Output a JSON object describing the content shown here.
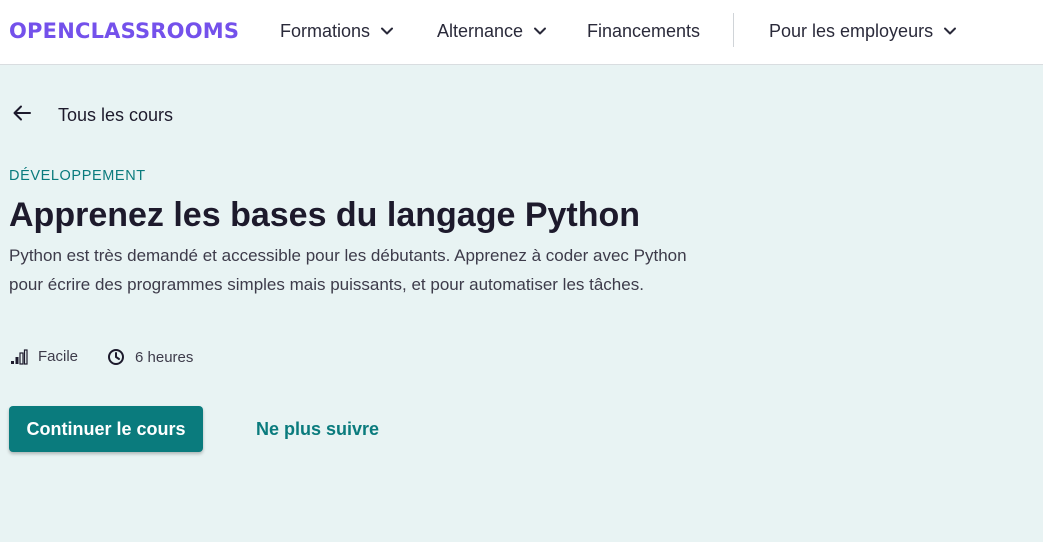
{
  "header": {
    "logo_text": "OPENCLASSROOMS",
    "nav": [
      {
        "label": "Formations",
        "has_dropdown": true
      },
      {
        "label": "Alternance",
        "has_dropdown": true
      },
      {
        "label": "Financements",
        "has_dropdown": false
      },
      {
        "label": "Pour les employeurs",
        "has_dropdown": true
      }
    ]
  },
  "back_link": {
    "label": "Tous les cours",
    "icon": "arrow-left-icon"
  },
  "course": {
    "category": "DÉVELOPPEMENT",
    "title": "Apprenez les bases du langage Python",
    "description": "Python est très demandé et accessible pour les débutants. Apprenez à coder avec Python pour écrire des programmes simples mais puissants, et pour automatiser les tâches.",
    "difficulty": "Facile",
    "difficulty_icon": "difficulty-bars-icon",
    "duration": "6 heures",
    "duration_icon": "clock-icon"
  },
  "actions": {
    "primary_label": "Continuer le cours",
    "secondary_label": "Ne plus suivre"
  },
  "colors": {
    "brand": "#7451eb",
    "accent": "#0a7b7d",
    "background": "#e8f3f3",
    "text": "#1d1a2c"
  }
}
